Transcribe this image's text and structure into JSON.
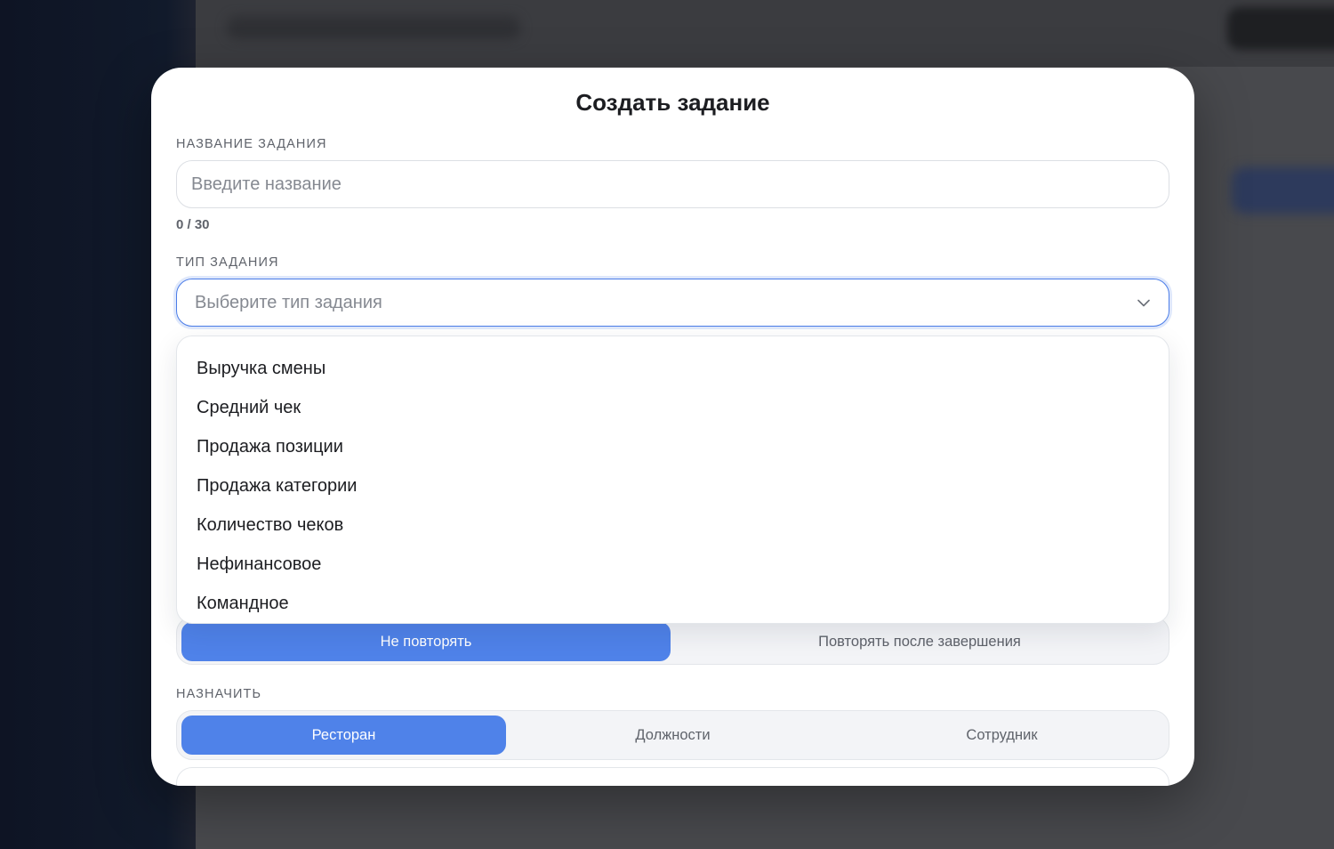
{
  "modal": {
    "title": "Создать задание"
  },
  "task_name": {
    "label": "НАЗВАНИЕ ЗАДАНИЯ",
    "placeholder": "Введите название",
    "value": "",
    "counter": "0 / 30"
  },
  "task_type": {
    "label": "ТИП ЗАДАНИЯ",
    "placeholder": "Выберите тип задания",
    "icon": "chevron-down-icon",
    "options": [
      "Выручка смены",
      "Средний чек",
      "Продажа позиции",
      "Продажа категории",
      "Количество чеков",
      "Нефинансовое",
      "Командное"
    ]
  },
  "repeat": {
    "options": [
      "Не повторять",
      "Повторять после завершения"
    ],
    "selected": "Не повторять"
  },
  "assign": {
    "label": "НАЗНАЧИТЬ",
    "options": [
      "Ресторан",
      "Должности",
      "Сотрудник"
    ],
    "selected": "Ресторан"
  },
  "colors": {
    "accent": "#4f82e9",
    "focus_border": "#4b7de8",
    "text": "#1c1d21",
    "muted": "#5f636b"
  }
}
